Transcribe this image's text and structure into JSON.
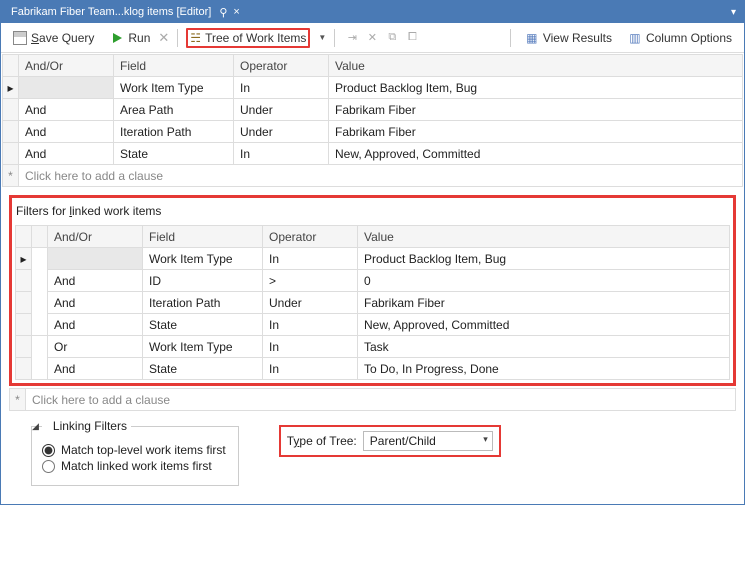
{
  "titlebar": {
    "tab_label": "Fabrikam Fiber Team...klog items [Editor]"
  },
  "toolbar": {
    "save": "Save Query",
    "run": "Run",
    "query_type": "Tree of Work Items",
    "view_results": "View Results",
    "column_options": "Column Options"
  },
  "headers": {
    "andor": "And/Or",
    "field": "Field",
    "operator": "Operator",
    "value": "Value"
  },
  "main_clauses": [
    {
      "andor": "",
      "field": "Work Item Type",
      "op": "In",
      "value": "Product Backlog Item, Bug"
    },
    {
      "andor": "And",
      "field": "Area Path",
      "op": "Under",
      "value": "Fabrikam Fiber"
    },
    {
      "andor": "And",
      "field": "Iteration Path",
      "op": "Under",
      "value": "Fabrikam Fiber"
    },
    {
      "andor": "And",
      "field": "State",
      "op": "In",
      "value": "New, Approved, Committed"
    }
  ],
  "add_clause": "Click here to add a clause",
  "linked": {
    "title": "Filters for linked work items",
    "clauses": [
      {
        "andor": "",
        "field": "Work Item Type",
        "op": "In",
        "value": "Product Backlog Item, Bug"
      },
      {
        "andor": "And",
        "field": "ID",
        "op": ">",
        "value": "0"
      },
      {
        "andor": "And",
        "field": "Iteration Path",
        "op": "Under",
        "value": "Fabrikam Fiber"
      },
      {
        "andor": "And",
        "field": "State",
        "op": "In",
        "value": "New, Approved, Committed"
      },
      {
        "andor": "Or",
        "field": "Work Item Type",
        "op": "In",
        "value": "Task"
      },
      {
        "andor": "And",
        "field": "State",
        "op": "In",
        "value": "To Do, In Progress, Done"
      }
    ]
  },
  "linking": {
    "legend": "Linking Filters",
    "opt_top": "Match top-level work items first",
    "opt_linked": "Match linked work items first",
    "tree_label": "Type of Tree:",
    "tree_value": "Parent/Child"
  }
}
